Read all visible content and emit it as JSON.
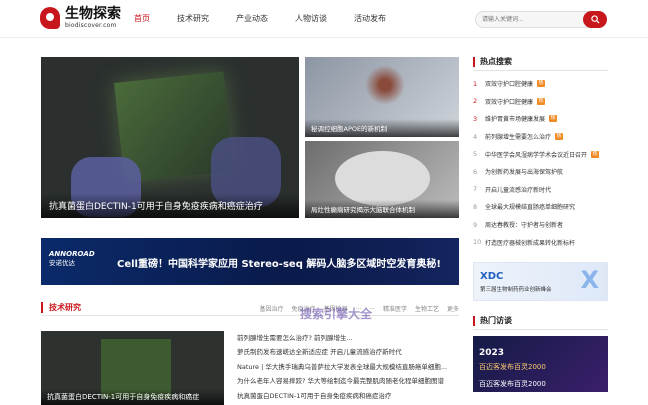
{
  "site": {
    "name_cn": "生物探索",
    "name_en": "biodiscover.com"
  },
  "nav": [
    "首页",
    "技术研究",
    "产业动态",
    "人物访谈",
    "活动发布"
  ],
  "search": {
    "placeholder": "请输入关键词..."
  },
  "hero": {
    "main": "抗真菌蛋白DECTIN-1可用于自身免疫疾病和癌症治疗",
    "side1": "秘调控细胞APOE的新机制",
    "side2": "局灶性癫痫研究揭示大脑联合体机制"
  },
  "banner": {
    "brand": "ANNOROAD",
    "brand_cn": "安诺优达",
    "title": "Cell重磅！中国科学家应用 Stereo-seq 解码人脑多区域时空发育奥秘!"
  },
  "section": {
    "title": "技术研究",
    "tabs": [
      "基因治疗",
      "免疫治疗",
      "基因检测",
      "...",
      "...",
      "精准医学",
      "生物工艺",
      "更多"
    ],
    "image_caption": "抗真菌蛋白DECTIN-1可用于自身免疫疾病和癌症",
    "items": [
      "前列腺增生需要怎么治疗? 前列腺增生...",
      "萝氏制药发布速嵯达全新适应症 开启儿童流感治疗新时代",
      "Nature | 华大携手瑞典乌普萨拉大学发表全球最大规模结直肠癌单细胞...",
      "为什么老年人容易摔跤? 华大等绘制迄今最完整肌肉随老化程单细胞图谱",
      "抗真菌蛋白DECTIN-1可用于自身免疫疾病和癌症治疗"
    ]
  },
  "hot_search": {
    "title": "热点搜索",
    "items": [
      {
        "rank": "1",
        "text": "双效守护口腔健康",
        "tag": true
      },
      {
        "rank": "2",
        "text": "双效守护口腔健康",
        "tag": true
      },
      {
        "rank": "3",
        "text": "维护胃黄市场健康发展",
        "tag": true
      },
      {
        "rank": "4",
        "text": "前列腺增生需要怎么治疗",
        "tag": true
      },
      {
        "rank": "5",
        "text": "中华医学会风湿病学学术会议近日召开",
        "tag": true
      },
      {
        "rank": "6",
        "text": "为创新药发展与出海保驾护航",
        "tag": false
      },
      {
        "rank": "7",
        "text": "开启儿童流感治疗新时代",
        "tag": false
      },
      {
        "rank": "8",
        "text": "全球最大规模结直肠癌单细胞研究",
        "tag": false
      },
      {
        "rank": "9",
        "text": "周达春教授：守护者与创新者",
        "tag": false
      },
      {
        "rank": "10",
        "text": "打造医疗器械创新成果转化新标杆",
        "tag": false
      }
    ]
  },
  "ad1": {
    "title": "XDC",
    "subtitle": "第三届生物制药药业创新峰会"
  },
  "hot_interview": {
    "title": "热门访谈"
  },
  "ad2": {
    "year": "2023",
    "slogan": "百迈客发布百灵2000",
    "caption": "百迈客发布百灵2000"
  },
  "watermark": "搜索引擎大全",
  "colors": {
    "brand": "#c8161d",
    "tag": "#f08a24"
  }
}
